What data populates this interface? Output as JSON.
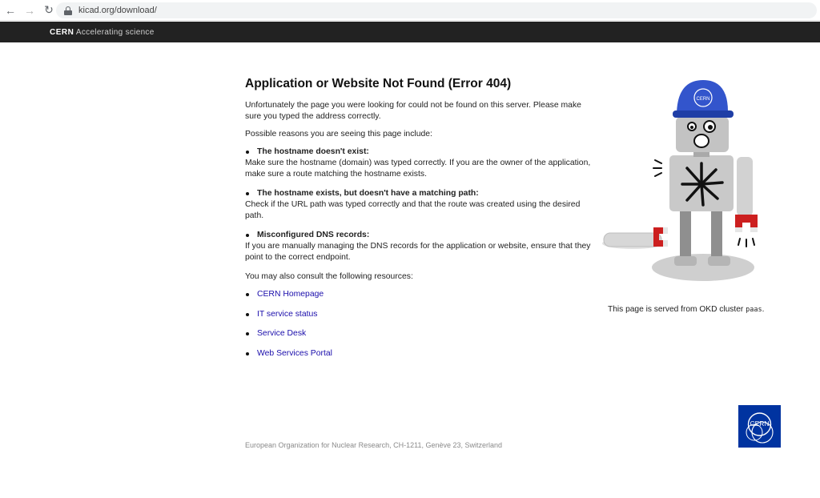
{
  "browser": {
    "url": "kicad.org/download/"
  },
  "cernbar": {
    "brand": "CERN",
    "tagline": "Accelerating science"
  },
  "main": {
    "title": "Application or Website Not Found (Error 404)",
    "intro": "Unfortunately the page you were looking for could not be found on this server. Please make sure you typed the address correctly.",
    "reasons_intro": "Possible reasons you are seeing this page include:",
    "reasons": [
      {
        "title": "The hostname doesn't exist:",
        "text": "Make sure the hostname (domain) was typed correctly. If you are the owner of the application, make sure a route matching the hostname exists."
      },
      {
        "title": "The hostname exists, but doesn't have a matching path:",
        "text": "Check if the URL path was typed correctly and that the route was created using the desired path."
      },
      {
        "title": "Misconfigured DNS records:",
        "text": "If you are manually managing the DNS records for the application or website, ensure that they point to the correct endpoint."
      }
    ],
    "resources_intro": "You may also consult the following resources:",
    "resources": [
      {
        "label": "CERN Homepage"
      },
      {
        "label": "IT service status"
      },
      {
        "label": "Service Desk"
      },
      {
        "label": "Web Services Portal"
      }
    ]
  },
  "side": {
    "cluster_text": "This page is served from OKD cluster",
    "cluster_name": "paas",
    "cluster_suffix": "."
  },
  "footer": {
    "text": "European Organization for Nuclear Research, CH-1211, Genève 23, Switzerland"
  },
  "logo": {
    "text": "CERN"
  },
  "colors": {
    "cern_bar": "#222222",
    "link": "#1a0dab",
    "cern_blue": "#0033a0"
  }
}
